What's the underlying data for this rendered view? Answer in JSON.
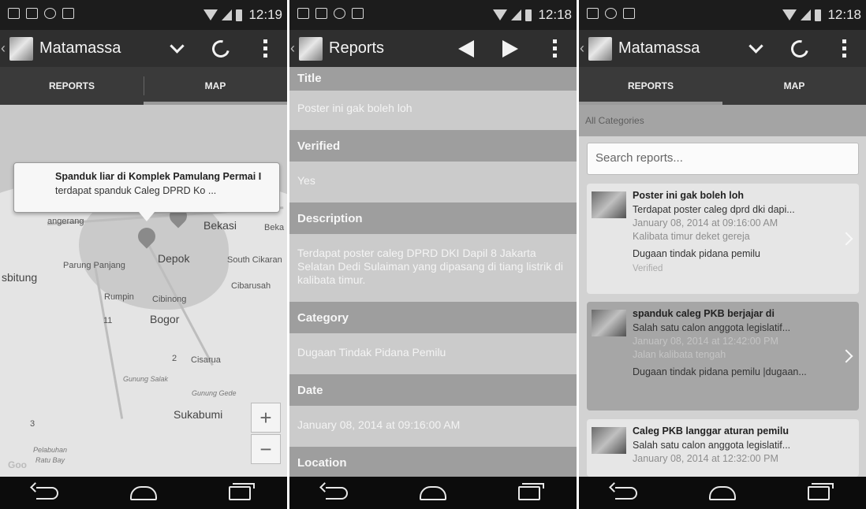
{
  "status_bar": {
    "phone1_time": "12:19",
    "phone2_time": "12:18",
    "phone3_time": "12:18"
  },
  "phone1": {
    "app_title": "Matamassa",
    "tabs": [
      "REPORTS",
      "MAP"
    ],
    "active_tab": "MAP",
    "map": {
      "infowindow_title": "Spanduk liar di Komplek Pamulang Permai I",
      "infowindow_desc": "terdapat spanduk Caleg DPRD Ko ...",
      "places": {
        "bekasi": "Bekasi",
        "beka": "Beka",
        "depok": "Depok",
        "parung_panjang": "Parung Panjang",
        "south_cikarang": "South Cikaran",
        "sbitung": "sbitung",
        "cibarusah": "Cibarusah",
        "rumpin": "Rumpin",
        "cibinong": "Cibinong",
        "bogor": "Bogor",
        "cisarua": "Cisarua",
        "gunung_salak": "Gunung Salak",
        "gunung_gede": "Gunung Gede",
        "sukabumi": "Sukabumi",
        "pelabuhan": "Pelabuhan",
        "ratu_bay": "Ratu Bay",
        "tangerang": "angerang",
        "route_11": "11",
        "route_2": "2",
        "route_3": "3"
      },
      "zoom_in": "+",
      "zoom_out": "−",
      "google": "Goo"
    }
  },
  "phone2": {
    "app_title": "Reports",
    "sections": [
      {
        "label": "Title",
        "value": "Poster ini gak boleh loh"
      },
      {
        "label": "Verified",
        "value": "Yes"
      },
      {
        "label": "Description",
        "value": "Terdapat poster caleg DPRD DKI Dapil 8 Jakarta Selatan Dedi Sulaiman yang dipasang di tiang listrik di kalibata timur."
      },
      {
        "label": "Category",
        "value": "Dugaan Tindak Pidana Pemilu"
      },
      {
        "label": "Date",
        "value": "January 08, 2014 at 09:16:00 AM"
      },
      {
        "label": "Location",
        "value": ""
      }
    ]
  },
  "phone3": {
    "app_title": "Matamassa",
    "tabs": [
      "REPORTS",
      "MAP"
    ],
    "active_tab": "REPORTS",
    "category_filter": "All Categories",
    "search_placeholder": "Search reports...",
    "reports": [
      {
        "title": "Poster ini gak boleh loh",
        "desc": "Terdapat poster caleg dprd dki dapi...",
        "date": "January 08, 2014 at 09:16:00 AM",
        "location": "Kalibata timur deket gereja",
        "category": "Dugaan tindak pidana pemilu",
        "status": "Verified"
      },
      {
        "title": "spanduk caleg PKB berjajar di",
        "desc": "Salah satu calon anggota legislatif...",
        "date": "January 08, 2014 at 12:42:00 PM",
        "location": "Jalan kalibata tengah",
        "category": "Dugaan tindak pidana pemilu |dugaan...",
        "status": ""
      },
      {
        "title": "Caleg PKB langgar aturan pemilu",
        "desc": "Salah satu calon anggota legislatif...",
        "date": "January 08, 2014 at 12:32:00 PM",
        "location": "",
        "category": "",
        "status": ""
      }
    ]
  }
}
